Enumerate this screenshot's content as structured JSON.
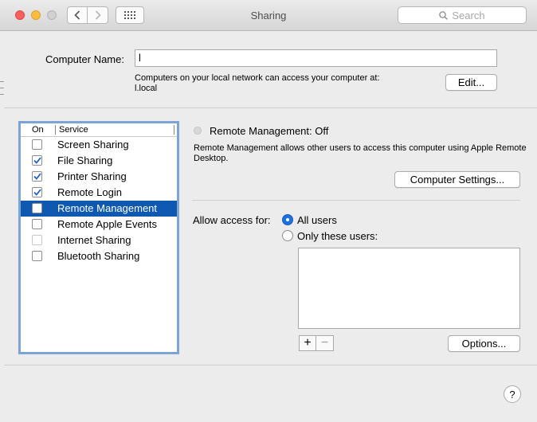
{
  "window": {
    "title": "Sharing",
    "search_placeholder": "Search"
  },
  "computer_name": {
    "label": "Computer Name:",
    "value": "l",
    "description_line1": "Computers on your local network can access your computer at:",
    "description_line2": "l.local",
    "edit_label": "Edit..."
  },
  "services": {
    "header_on": "On",
    "header_service": "Service",
    "items": [
      {
        "label": "Screen Sharing",
        "checked": false,
        "selected": false
      },
      {
        "label": "File Sharing",
        "checked": true,
        "selected": false
      },
      {
        "label": "Printer Sharing",
        "checked": true,
        "selected": false
      },
      {
        "label": "Remote Login",
        "checked": true,
        "selected": false
      },
      {
        "label": "Remote Management",
        "checked": false,
        "selected": true
      },
      {
        "label": "Remote Apple Events",
        "checked": false,
        "selected": false
      },
      {
        "label": "Internet Sharing",
        "checked": false,
        "selected": false,
        "disabled": true
      },
      {
        "label": "Bluetooth Sharing",
        "checked": false,
        "selected": false
      }
    ]
  },
  "detail": {
    "status": "Remote Management: Off",
    "description": "Remote Management allows other users to access this computer using Apple Remote Desktop.",
    "computer_settings_label": "Computer Settings...",
    "allow_access_label": "Allow access for:",
    "option_all": "All users",
    "option_only": "Only these users:",
    "add_label": "+",
    "remove_label": "−",
    "options_label": "Options..."
  },
  "help_label": "?",
  "colors": {
    "selection": "#0f5ab0",
    "checkmark": "#1f5fc9",
    "radio_on": "#1f6fe0"
  }
}
